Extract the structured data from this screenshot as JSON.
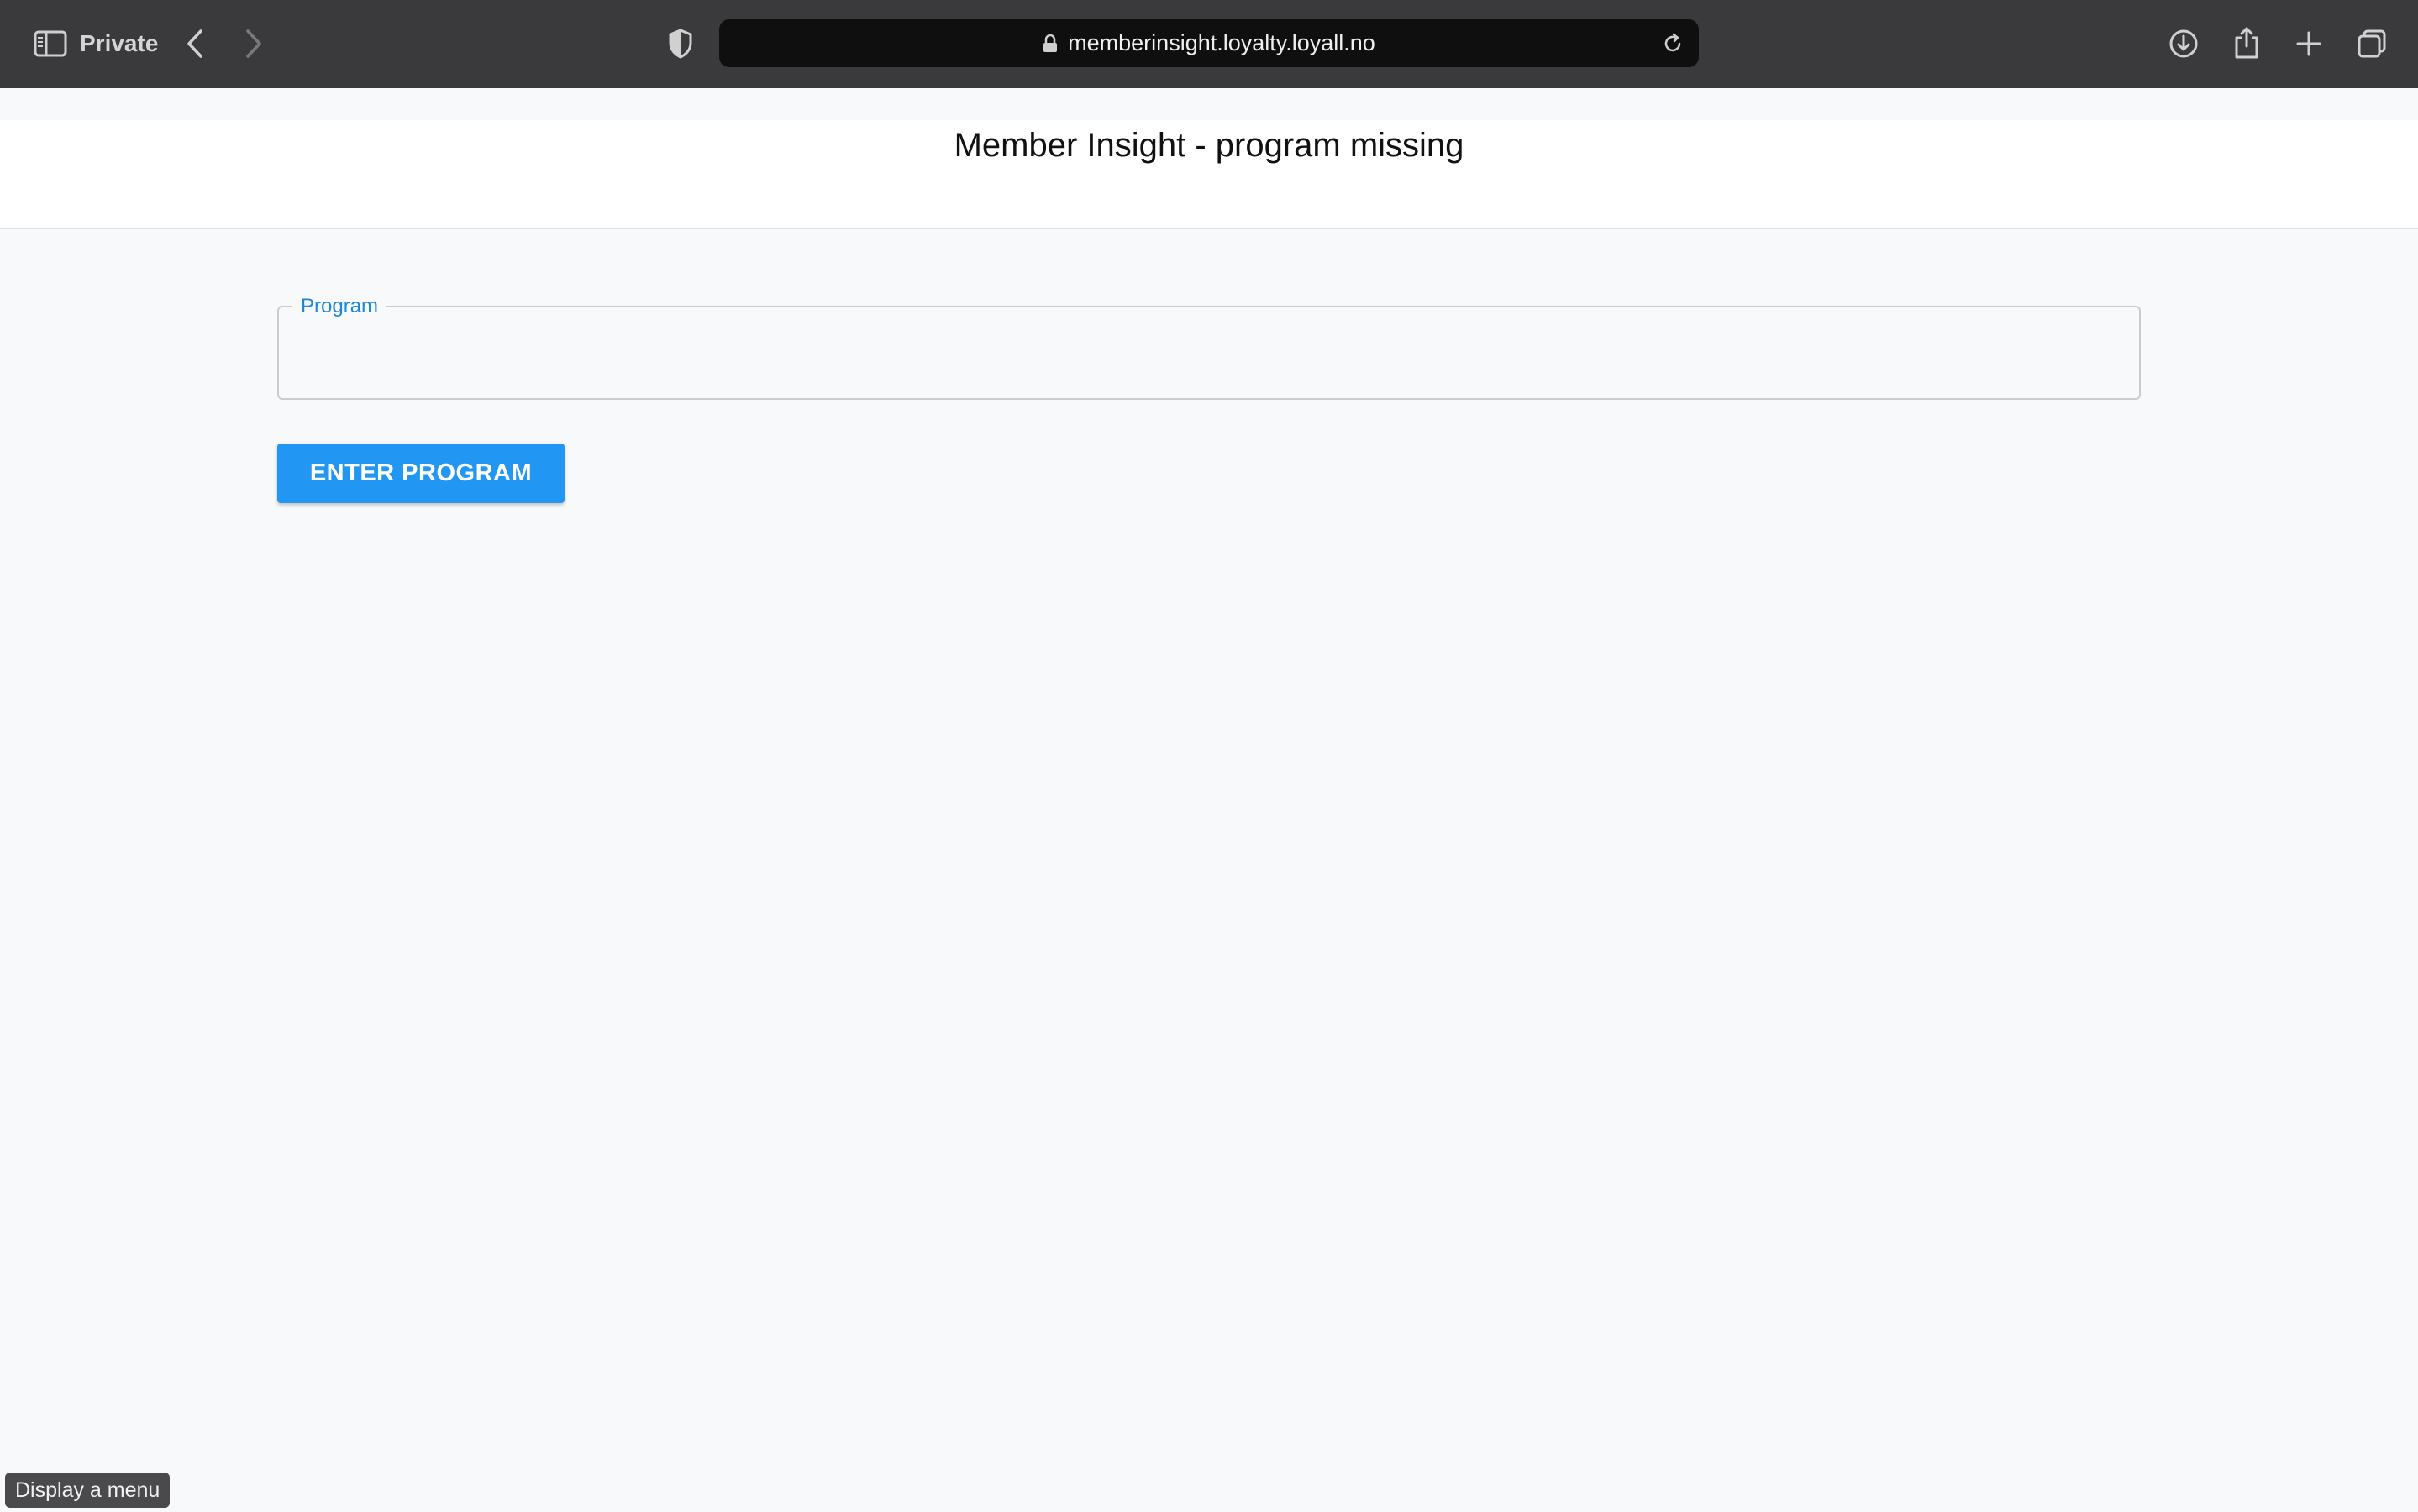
{
  "browser": {
    "private_label": "Private",
    "url": "memberinsight.loyalty.loyall.no",
    "icons": {
      "sidebar": "sidebar-icon",
      "back": "chevron-left-icon",
      "forward": "chevron-right-icon",
      "shield": "shield-icon",
      "lock": "lock-icon",
      "reload": "reload-icon",
      "download": "download-icon",
      "share": "share-icon",
      "new_tab": "plus-icon",
      "tabs": "tabs-overview-icon"
    }
  },
  "page": {
    "title": "Member Insight - program missing",
    "program_field": {
      "label": "Program",
      "value": "",
      "placeholder": ""
    },
    "enter_button_label": "ENTER PROGRAM",
    "accent_color": "#2196f3",
    "label_color": "#1e88d8"
  },
  "tooltip": {
    "text": "Display a menu"
  }
}
